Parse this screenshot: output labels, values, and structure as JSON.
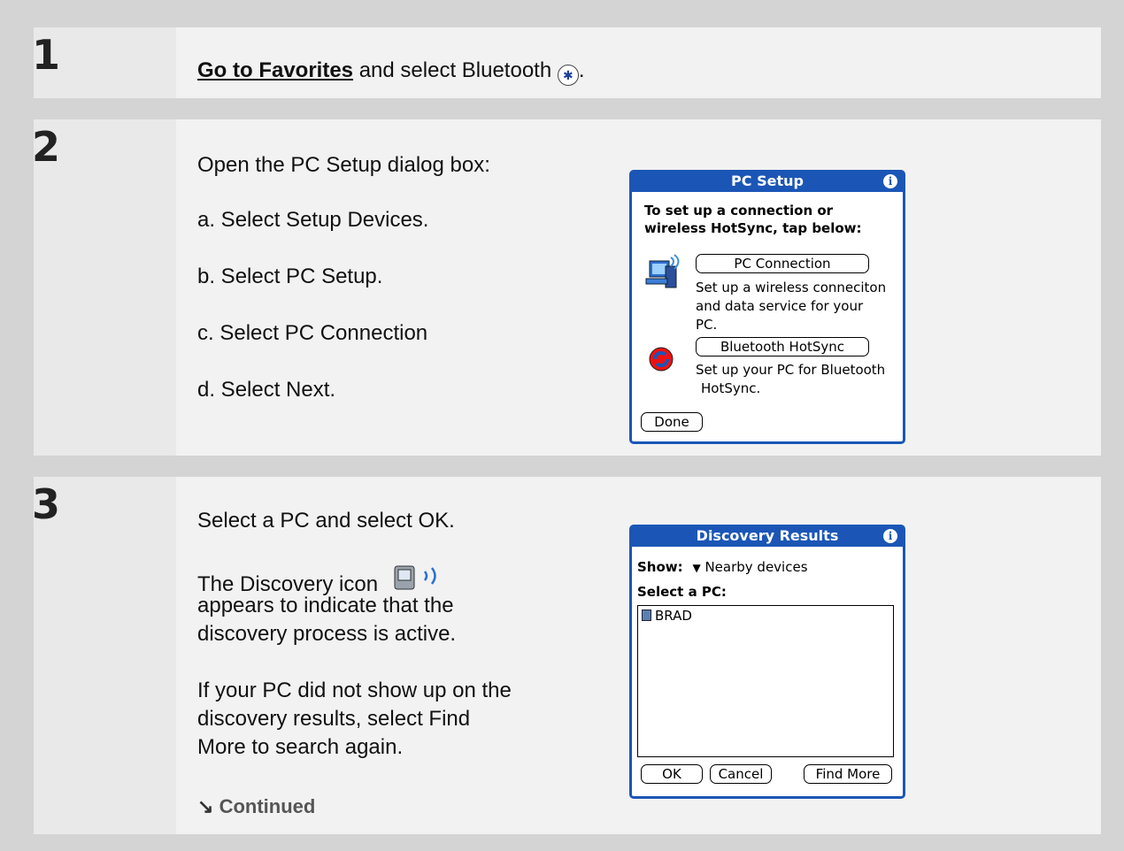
{
  "step1": {
    "number": "1",
    "link": "Go to Favorites",
    "text": " and select Bluetooth ",
    "icon": "bluetooth-icon",
    "end": "."
  },
  "step2": {
    "number": "2",
    "intro": "Open the PC Setup dialog box:",
    "items": [
      "a.  Select Setup Devices.",
      "b.  Select PC Setup.",
      "c.  Select PC Connection",
      "d.  Select Next."
    ],
    "dialog": {
      "title": "PC Setup",
      "heading1": "To set up a connection or",
      "heading2": "wireless HotSync, tap below:",
      "btn1": "PC Connection",
      "desc1a": "Set up a wireless conneciton",
      "desc1b": "and data service for your",
      "desc1c": "PC.",
      "btn2": "Bluetooth HotSync",
      "desc2a": "Set up your PC for Bluetooth",
      "desc2b": "HotSync.",
      "done": "Done"
    }
  },
  "step3": {
    "number": "3",
    "p1": "Select a PC and select OK.",
    "p2a": "The Discovery icon",
    "p2b": "appears to indicate that the",
    "p2c": "discovery process is active.",
    "p3a": "If your PC did not show up on the",
    "p3b": "discovery results, select Find",
    "p3c": "More to search again.",
    "continued": "Continued",
    "dialog": {
      "title": "Discovery Results",
      "show_label": "Show:",
      "show_value": "Nearby devices",
      "select_label": "Select a PC:",
      "devices": [
        "BRAD"
      ],
      "ok": "OK",
      "cancel": "Cancel",
      "find_more": "Find More"
    }
  }
}
